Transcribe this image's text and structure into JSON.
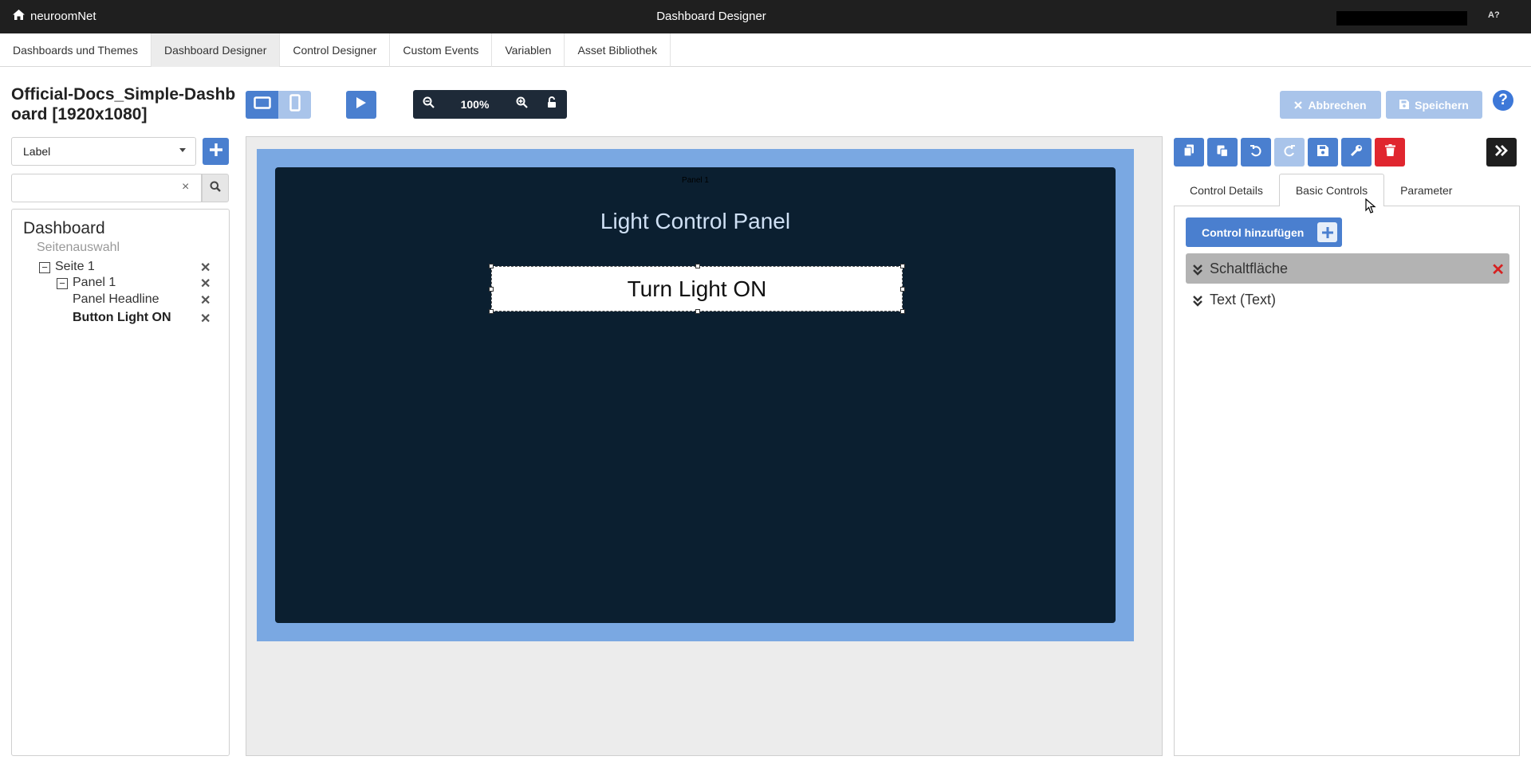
{
  "topbar": {
    "brand": "neuroomNet",
    "title": "Dashboard Designer",
    "lang_icon": "A?",
    "home_icon": "home-icon"
  },
  "nav": {
    "tabs": [
      {
        "label": "Dashboards und Themes",
        "active": false
      },
      {
        "label": "Dashboard Designer",
        "active": true
      },
      {
        "label": "Control Designer",
        "active": false
      },
      {
        "label": "Custom Events",
        "active": false
      },
      {
        "label": "Variablen",
        "active": false
      },
      {
        "label": "Asset Bibliothek",
        "active": false
      }
    ]
  },
  "document": {
    "title": "Official-Docs_Simple-Dashboard [1920x1080]"
  },
  "toolbar": {
    "zoom": "100%",
    "cancel_label": "Abbrechen",
    "save_label": "Speichern",
    "help": "?"
  },
  "left": {
    "select_value": "Label",
    "search_value": "",
    "clear": "×",
    "tree": {
      "root": "Dashboard",
      "subtitle": "Seitenauswahl",
      "items": [
        {
          "label": "Seite 1",
          "toggle": "−",
          "level": 1
        },
        {
          "label": "Panel 1",
          "toggle": "−",
          "level": 2
        },
        {
          "label": "Panel Headline",
          "level": 3
        },
        {
          "label": "Button Light ON",
          "level": 3,
          "selected": true
        }
      ],
      "delete": "✕"
    }
  },
  "canvas": {
    "panel_tag": "Panel 1",
    "headline": "Light Control Panel",
    "button_label": "Turn Light ON"
  },
  "right": {
    "tabs": [
      {
        "label": "Control Details",
        "active": false
      },
      {
        "label": "Basic Controls",
        "active": true
      },
      {
        "label": "Parameter",
        "active": false
      }
    ],
    "add_control_label": "Control hinzufügen",
    "controls": [
      {
        "label": "Schaltfläche",
        "selected": true,
        "remove": "✕"
      },
      {
        "label": "Text (Text)",
        "selected": false
      }
    ]
  },
  "colors": {
    "topbar": "#1f1f1f",
    "primary": "#4a7fcf",
    "primary_disabled": "#a9c4ea",
    "danger": "#e0262f",
    "stage": "#7aa8e2",
    "panel": "#0b1f30"
  }
}
